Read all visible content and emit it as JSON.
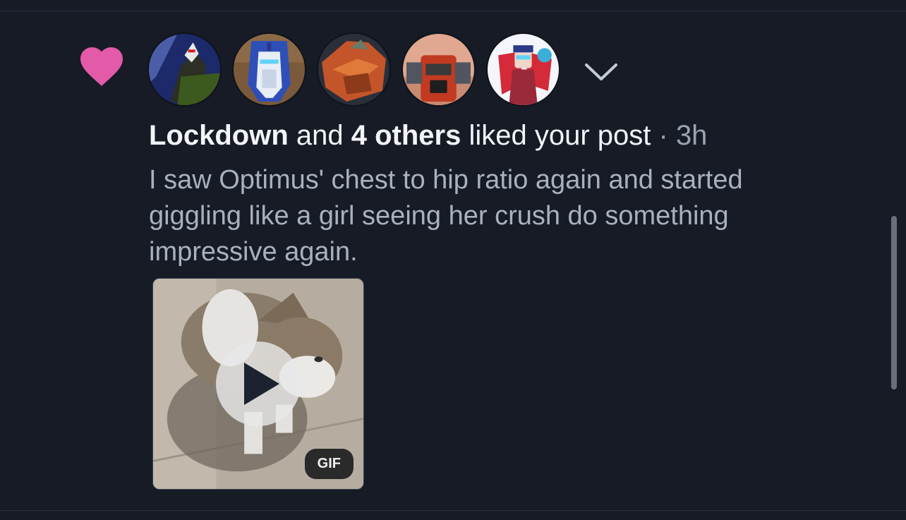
{
  "notification": {
    "actor": "Lockdown",
    "connector": " and ",
    "others": "4 others",
    "action": " liked your post",
    "time": " · 3h",
    "post_text": "I saw Optimus' chest to hip ratio again and started giggling like a girl seeing her crush do something impressive again.",
    "media_badge": "GIF"
  },
  "icons": {
    "heart": "heart-icon",
    "expand": "chevron-down-icon",
    "play": "play-icon"
  },
  "colors": {
    "background": "#161b26",
    "heart": "#e35aa8",
    "primary_text": "#f2f4f7",
    "secondary_text": "#a9b1bf"
  }
}
